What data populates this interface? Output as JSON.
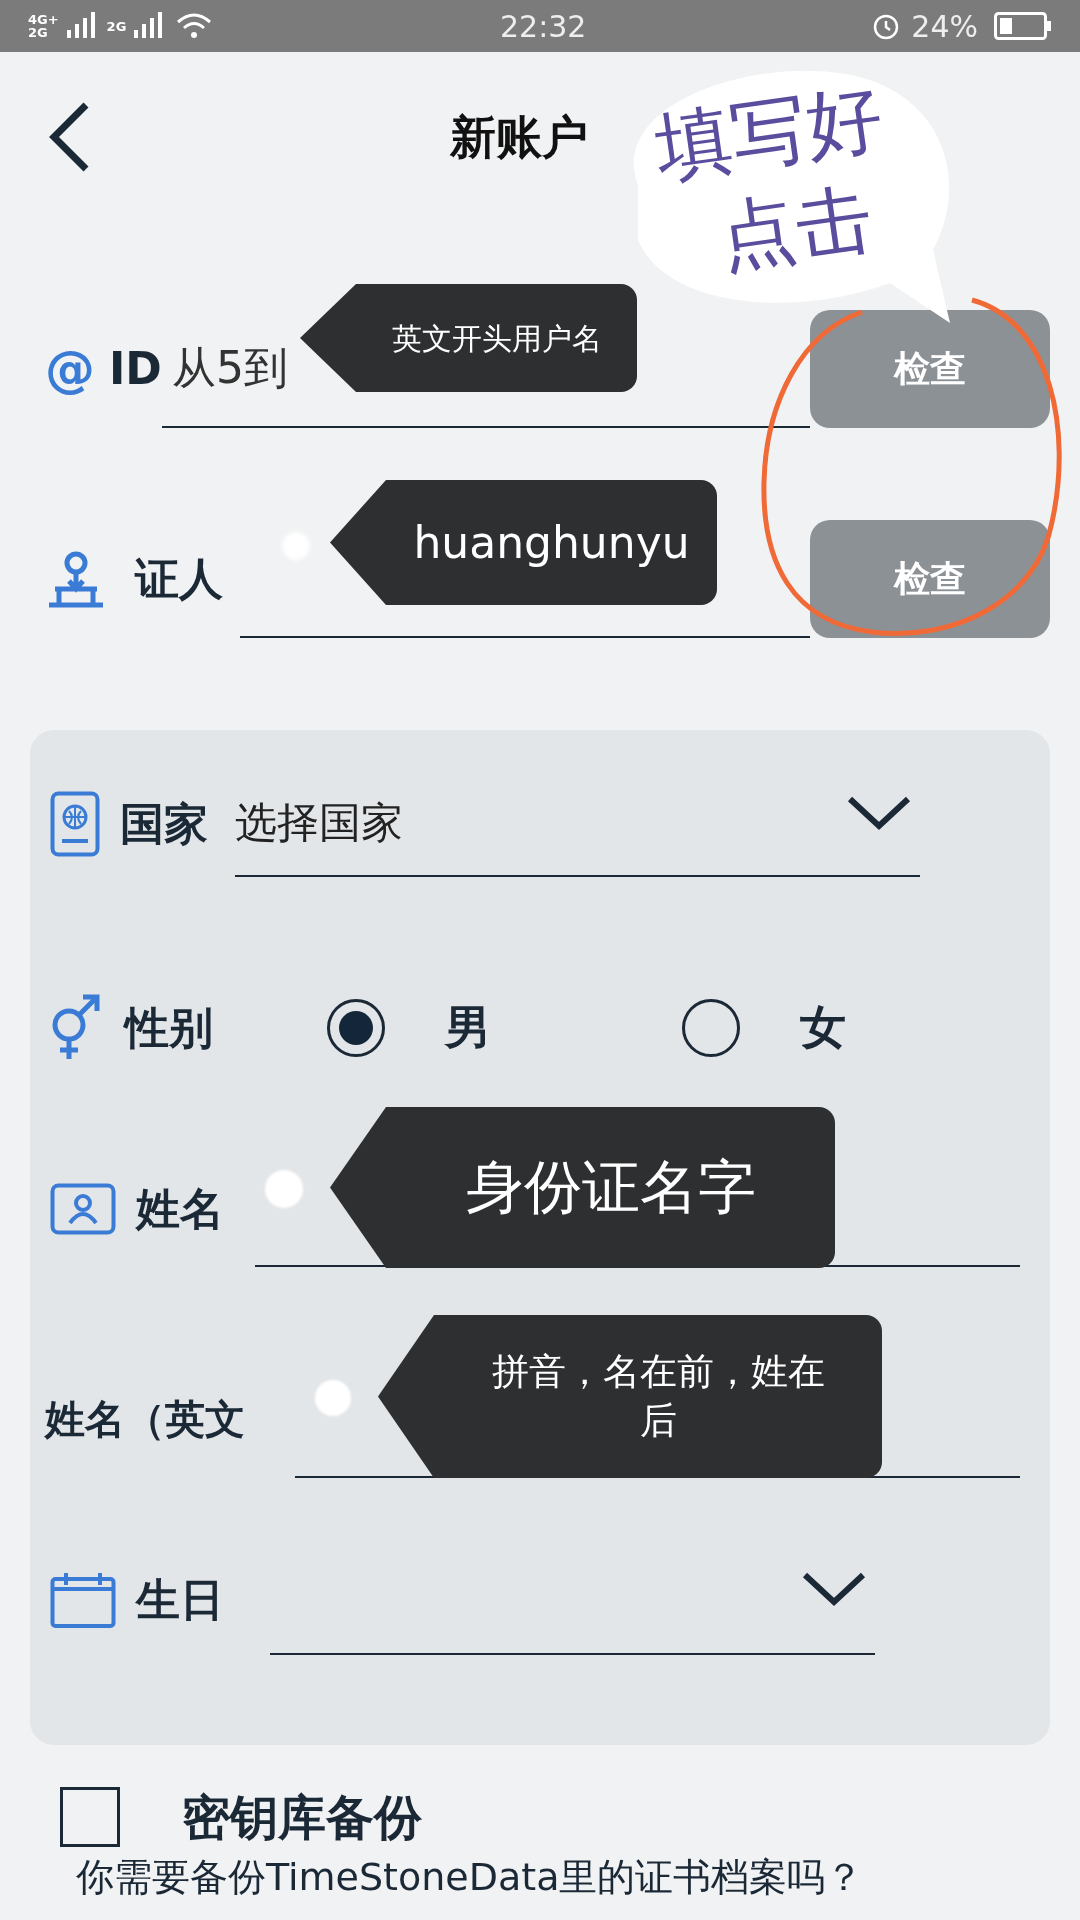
{
  "status_bar": {
    "signal_labels": [
      "4G+",
      "2G",
      "2G"
    ],
    "time": "22:32",
    "battery": "24%"
  },
  "header": {
    "title": "新账户"
  },
  "callout": {
    "lines": [
      "填写好",
      "点击"
    ]
  },
  "form": [
    {
      "icon_glyph": "@",
      "label": "ID",
      "placeholder": "从5到",
      "button": "检查",
      "tooltip": "英文开头用户名"
    },
    {
      "label": "证人",
      "button": "检查",
      "tooltip": "huanghunyu"
    }
  ],
  "card": [
    {
      "kind": "select",
      "label": "国家",
      "value": "选择国家"
    },
    {
      "kind": "radio",
      "label": "性别",
      "options": [
        {
          "label": "男",
          "selected": true
        },
        {
          "label": "女",
          "selected": false
        }
      ]
    },
    {
      "kind": "text",
      "label": "姓名",
      "tooltip": "身份证名字"
    },
    {
      "kind": "text",
      "label": "姓名（英文",
      "tooltip": "拼音，名在前，姓在后"
    },
    {
      "kind": "select",
      "label": "生日"
    }
  ],
  "backup": {
    "checked": false,
    "label": "密钥库备份",
    "description": "你需要备份TimeStoneData里的证书档案吗？"
  }
}
